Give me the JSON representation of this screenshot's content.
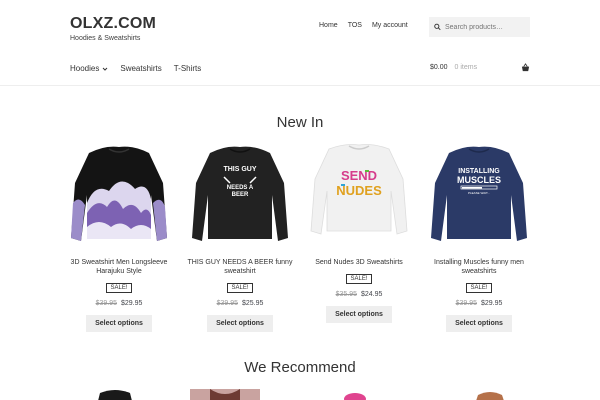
{
  "site": {
    "title": "OLXZ.COM",
    "description": "Hoodies & Sweatshirts"
  },
  "secondary_nav": [
    "Home",
    "TOS",
    "My account"
  ],
  "search": {
    "placeholder": "Search products…"
  },
  "primary_nav": {
    "hoodies": "Hoodies",
    "sweatshirts": "Sweatshirts",
    "tshirts": "T-Shirts"
  },
  "cart": {
    "total": "$0.00",
    "count": "0 items"
  },
  "new_in": {
    "title": "New In",
    "products": [
      {
        "name": "3D Sweatshirt Men Longsleeve Harajuku Style",
        "badge": "SALE!",
        "old_price": "$39.95",
        "price": "$29.95",
        "button": "Select options"
      },
      {
        "name": "THIS GUY NEEDS A BEER funny sweatshirt",
        "badge": "SALE!",
        "old_price": "$39.95",
        "price": "$25.95",
        "button": "Select options"
      },
      {
        "name": "Send Nudes 3D Sweatshirts",
        "badge": "SALE!",
        "old_price": "$35.95",
        "price": "$24.95",
        "button": "Select options"
      },
      {
        "name": "Installing Muscles funny men sweatshirts",
        "badge": "SALE!",
        "old_price": "$39.95",
        "price": "$29.95",
        "button": "Select options"
      }
    ],
    "print_text": {
      "p2": "THIS GUY NEEDS A BEER",
      "p3_line1": "SEND",
      "p3_line2": "NUDES",
      "p4_line1": "INSTALLING",
      "p4_line2": "MUSCLES",
      "p4_line3": "PLEASE WAIT..."
    }
  },
  "we_recommend": {
    "title": "We Recommend"
  },
  "colors": {
    "accent": "#333333",
    "button_bg": "#eeeeee",
    "navy": "#2b3a67"
  }
}
